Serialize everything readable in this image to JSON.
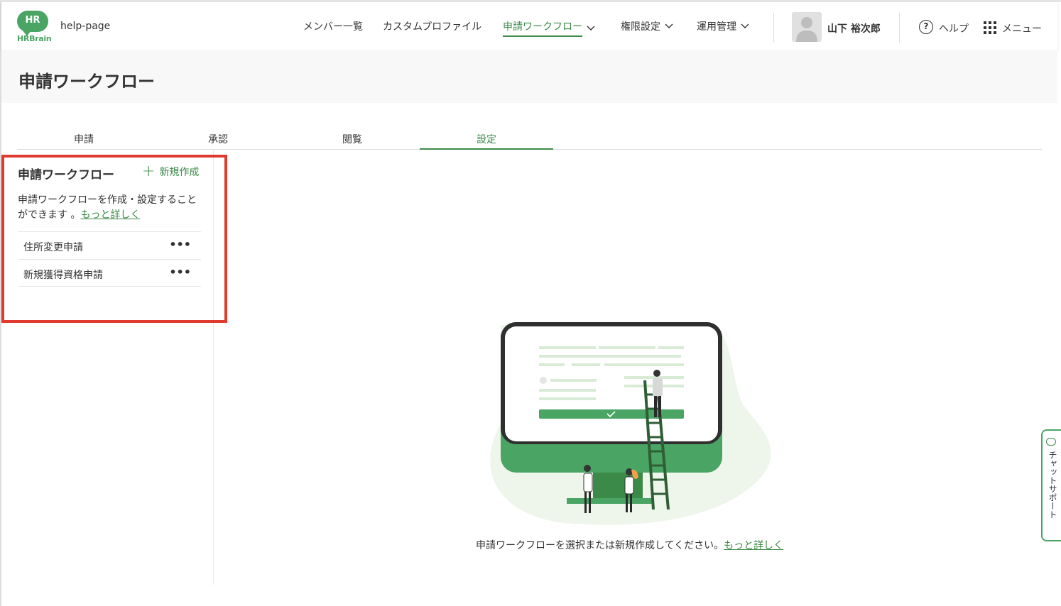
{
  "header": {
    "logo_text": "HR",
    "logo_brand": "HRBrain",
    "org": "help-page",
    "nav": [
      {
        "label": "メンバー一覧"
      },
      {
        "label": "カスタムプロファイル"
      },
      {
        "label": "申請ワークフロー"
      },
      {
        "label": "権限設定"
      },
      {
        "label": "運用管理"
      }
    ],
    "user": "山下 裕次郎",
    "help_label": "ヘルプ",
    "menu_label": "メニュー"
  },
  "page": {
    "title": "申請ワークフロー"
  },
  "tabs": [
    {
      "label": "申請"
    },
    {
      "label": "承認"
    },
    {
      "label": "閲覧"
    },
    {
      "label": "設定"
    }
  ],
  "sidebar": {
    "title": "申請ワークフロー",
    "new_label": "新規作成",
    "description": "申請ワークフローを作成・設定することができます 。",
    "more_link": "もっと詳しく",
    "items": [
      {
        "label": "住所変更申請",
        "menu": "•••"
      },
      {
        "label": "新規獲得資格申請",
        "menu": "•••"
      }
    ]
  },
  "main": {
    "message": "申請ワークフローを選択または新規作成してください。",
    "more_link": "もっと詳しく"
  },
  "chat": {
    "label": "チャットサポート"
  },
  "colors": {
    "accent": "#3b8a47",
    "highlight": "#e03a2f"
  }
}
